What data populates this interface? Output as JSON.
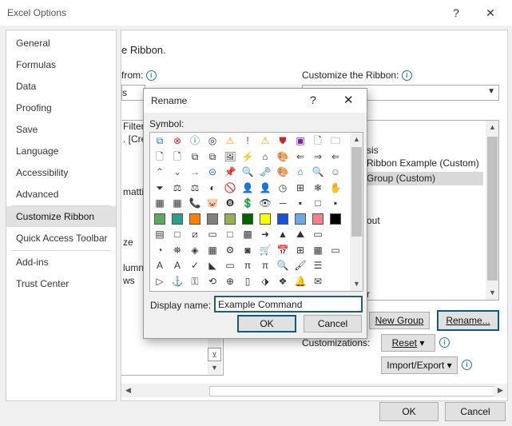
{
  "window": {
    "title": "Excel Options",
    "help_glyph": "?",
    "close_glyph": "✕"
  },
  "nav": {
    "items": [
      "General",
      "Formulas",
      "Data",
      "Proofing",
      "Save",
      "Language",
      "Accessibility",
      "Advanced",
      "Customize Ribbon",
      "Quick Access Toolbar",
      "Add-ins",
      "Trust Center"
    ],
    "selected": "Customize Ribbon"
  },
  "main": {
    "heading_fragment": "e Ribbon.",
    "choose_from_label": "from:",
    "choose_from_value": "s",
    "customize_ribbon_label": "Customize the Ribbon:",
    "left_list_fragments": [
      "Filter",
      ". [Cre",
      "matti",
      "ze",
      "lumn",
      "ws"
    ],
    "right_list_items": [
      "sis",
      "Ribbon Example (Custom)",
      "Group (Custom)",
      "out",
      "r"
    ],
    "right_list_selected": "Group (Custom)",
    "new_group_button": "New Group",
    "rename_button": "Rename...",
    "customizations_label": "Customizations:",
    "reset_button": "Reset",
    "import_export_button": "Import/Export",
    "ok_button": "OK",
    "cancel_button": "Cancel"
  },
  "rename_dialog": {
    "title": "Rename",
    "help_glyph": "?",
    "close_glyph": "✕",
    "symbol_label": "Symbol:",
    "display_name_label": "Display name:",
    "display_name_value": "Example Command",
    "ok_button": "OK",
    "cancel_button": "Cancel",
    "symbol_rows": [
      [
        "⧉",
        "⊗",
        "ⓘ",
        "◎",
        "⚠",
        "!",
        "⚠",
        "⛊",
        "▣",
        "🗋",
        "🗀"
      ],
      [
        "🗋",
        "🗋",
        "⧉",
        "⧉",
        "🖼",
        "⚡",
        "⌂",
        "🎨",
        "⇐",
        "⇒",
        "⇐"
      ],
      [
        "⌃",
        "⌄",
        "→",
        "⊝",
        "📌",
        "🔍",
        "🗝",
        "🎨",
        "⌂",
        "🔍",
        "☺"
      ],
      [
        "⏷",
        "⚖",
        "⚖",
        "◐",
        "🚫",
        "👤",
        "👤",
        "◷",
        "⊞",
        "❄",
        "✋"
      ],
      [
        "▦",
        "▦",
        "📞",
        "🐷",
        "❽",
        "💲",
        "👁",
        "─",
        "▪",
        "□",
        "▪"
      ],
      [
        "▪",
        "▪",
        "▪",
        "▪",
        "▪",
        "▪",
        "▪",
        "▪",
        "▪",
        "▪",
        "■"
      ],
      [
        "▤",
        "□",
        "⧄",
        "▭",
        "□",
        "▩",
        "➜",
        "▲",
        "⛰",
        "▭"
      ],
      [
        "◔",
        "⛯",
        "◈",
        "▦",
        "⚙",
        "◙",
        "🛒",
        "📅",
        "⊞",
        "▦",
        "▭"
      ],
      [
        "A",
        "A",
        "✓",
        "◣",
        "▭",
        "π",
        "π",
        "🔍",
        "🖌",
        "☰"
      ],
      [
        "▷",
        "⚓",
        "⚿",
        "⟲",
        "⊕",
        "▯",
        "⬗",
        "❖",
        "🔔",
        "✉"
      ]
    ],
    "colors": {
      "green": "#5ea862",
      "teal": "#2b9f8e",
      "orange": "#ff7f00",
      "gray": "#808080",
      "olive": "#9aaf52",
      "darkgreen": "#006400",
      "yellow": "#ffff00",
      "blue": "#1a52d6",
      "sky": "#6ea9e0",
      "pink": "#f2828a",
      "black": "#000000"
    }
  }
}
